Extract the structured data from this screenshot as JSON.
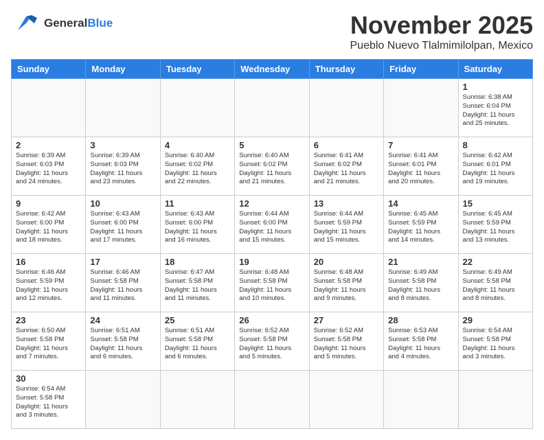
{
  "header": {
    "logo_general": "General",
    "logo_blue": "Blue",
    "month_title": "November 2025",
    "subtitle": "Pueblo Nuevo Tlalmimilolpan, Mexico"
  },
  "calendar": {
    "days_of_week": [
      "Sunday",
      "Monday",
      "Tuesday",
      "Wednesday",
      "Thursday",
      "Friday",
      "Saturday"
    ],
    "weeks": [
      [
        {
          "day": null,
          "info": null
        },
        {
          "day": null,
          "info": null
        },
        {
          "day": null,
          "info": null
        },
        {
          "day": null,
          "info": null
        },
        {
          "day": null,
          "info": null
        },
        {
          "day": null,
          "info": null
        },
        {
          "day": "1",
          "info": "Sunrise: 6:38 AM\nSunset: 6:04 PM\nDaylight: 11 hours\nand 25 minutes."
        }
      ],
      [
        {
          "day": "2",
          "info": "Sunrise: 6:39 AM\nSunset: 6:03 PM\nDaylight: 11 hours\nand 24 minutes."
        },
        {
          "day": "3",
          "info": "Sunrise: 6:39 AM\nSunset: 6:03 PM\nDaylight: 11 hours\nand 23 minutes."
        },
        {
          "day": "4",
          "info": "Sunrise: 6:40 AM\nSunset: 6:02 PM\nDaylight: 11 hours\nand 22 minutes."
        },
        {
          "day": "5",
          "info": "Sunrise: 6:40 AM\nSunset: 6:02 PM\nDaylight: 11 hours\nand 21 minutes."
        },
        {
          "day": "6",
          "info": "Sunrise: 6:41 AM\nSunset: 6:02 PM\nDaylight: 11 hours\nand 21 minutes."
        },
        {
          "day": "7",
          "info": "Sunrise: 6:41 AM\nSunset: 6:01 PM\nDaylight: 11 hours\nand 20 minutes."
        },
        {
          "day": "8",
          "info": "Sunrise: 6:42 AM\nSunset: 6:01 PM\nDaylight: 11 hours\nand 19 minutes."
        }
      ],
      [
        {
          "day": "9",
          "info": "Sunrise: 6:42 AM\nSunset: 6:00 PM\nDaylight: 11 hours\nand 18 minutes."
        },
        {
          "day": "10",
          "info": "Sunrise: 6:43 AM\nSunset: 6:00 PM\nDaylight: 11 hours\nand 17 minutes."
        },
        {
          "day": "11",
          "info": "Sunrise: 6:43 AM\nSunset: 6:00 PM\nDaylight: 11 hours\nand 16 minutes."
        },
        {
          "day": "12",
          "info": "Sunrise: 6:44 AM\nSunset: 6:00 PM\nDaylight: 11 hours\nand 15 minutes."
        },
        {
          "day": "13",
          "info": "Sunrise: 6:44 AM\nSunset: 5:59 PM\nDaylight: 11 hours\nand 15 minutes."
        },
        {
          "day": "14",
          "info": "Sunrise: 6:45 AM\nSunset: 5:59 PM\nDaylight: 11 hours\nand 14 minutes."
        },
        {
          "day": "15",
          "info": "Sunrise: 6:45 AM\nSunset: 5:59 PM\nDaylight: 11 hours\nand 13 minutes."
        }
      ],
      [
        {
          "day": "16",
          "info": "Sunrise: 6:46 AM\nSunset: 5:59 PM\nDaylight: 11 hours\nand 12 minutes."
        },
        {
          "day": "17",
          "info": "Sunrise: 6:46 AM\nSunset: 5:58 PM\nDaylight: 11 hours\nand 11 minutes."
        },
        {
          "day": "18",
          "info": "Sunrise: 6:47 AM\nSunset: 5:58 PM\nDaylight: 11 hours\nand 11 minutes."
        },
        {
          "day": "19",
          "info": "Sunrise: 6:48 AM\nSunset: 5:58 PM\nDaylight: 11 hours\nand 10 minutes."
        },
        {
          "day": "20",
          "info": "Sunrise: 6:48 AM\nSunset: 5:58 PM\nDaylight: 11 hours\nand 9 minutes."
        },
        {
          "day": "21",
          "info": "Sunrise: 6:49 AM\nSunset: 5:58 PM\nDaylight: 11 hours\nand 8 minutes."
        },
        {
          "day": "22",
          "info": "Sunrise: 6:49 AM\nSunset: 5:58 PM\nDaylight: 11 hours\nand 8 minutes."
        }
      ],
      [
        {
          "day": "23",
          "info": "Sunrise: 6:50 AM\nSunset: 5:58 PM\nDaylight: 11 hours\nand 7 minutes."
        },
        {
          "day": "24",
          "info": "Sunrise: 6:51 AM\nSunset: 5:58 PM\nDaylight: 11 hours\nand 6 minutes."
        },
        {
          "day": "25",
          "info": "Sunrise: 6:51 AM\nSunset: 5:58 PM\nDaylight: 11 hours\nand 6 minutes."
        },
        {
          "day": "26",
          "info": "Sunrise: 6:52 AM\nSunset: 5:58 PM\nDaylight: 11 hours\nand 5 minutes."
        },
        {
          "day": "27",
          "info": "Sunrise: 6:52 AM\nSunset: 5:58 PM\nDaylight: 11 hours\nand 5 minutes."
        },
        {
          "day": "28",
          "info": "Sunrise: 6:53 AM\nSunset: 5:58 PM\nDaylight: 11 hours\nand 4 minutes."
        },
        {
          "day": "29",
          "info": "Sunrise: 6:54 AM\nSunset: 5:58 PM\nDaylight: 11 hours\nand 3 minutes."
        }
      ],
      [
        {
          "day": "30",
          "info": "Sunrise: 6:54 AM\nSunset: 5:58 PM\nDaylight: 11 hours\nand 3 minutes."
        },
        {
          "day": null,
          "info": null
        },
        {
          "day": null,
          "info": null
        },
        {
          "day": null,
          "info": null
        },
        {
          "day": null,
          "info": null
        },
        {
          "day": null,
          "info": null
        },
        {
          "day": null,
          "info": null
        }
      ]
    ]
  }
}
